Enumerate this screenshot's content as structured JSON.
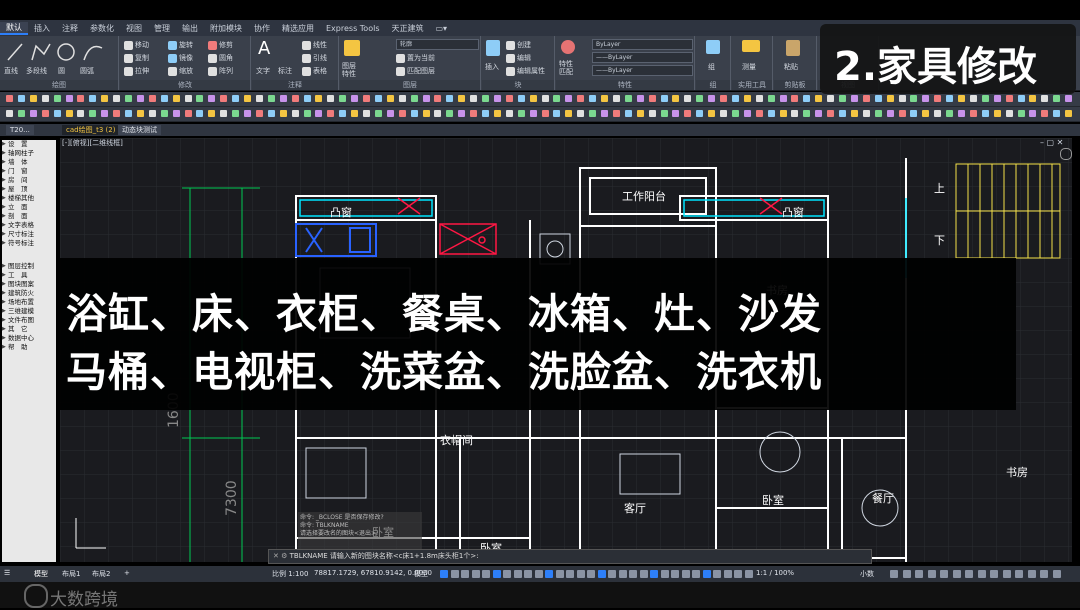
{
  "menu": {
    "tabs": [
      "默认",
      "插入",
      "注释",
      "参数化",
      "视图",
      "管理",
      "输出",
      "附加模块",
      "协作",
      "精选应用",
      "Express Tools",
      "天正建筑",
      "▭▾"
    ]
  },
  "ribbon": {
    "draw": {
      "label": "绘图",
      "line": "直线",
      "polyline": "多段线",
      "circle": "圆",
      "arc": "圆弧"
    },
    "modify": {
      "label": "修改",
      "move": "移动",
      "rotate": "旋转",
      "trim": "修剪",
      "copy": "复制",
      "mirror": "镜像",
      "fillet": "圆角",
      "stretch": "拉伸",
      "scale": "缩放",
      "array": "阵列"
    },
    "annotation": {
      "label": "注释",
      "text": "文字",
      "dimension": "标注",
      "linear": "线性",
      "leader": "引线",
      "table": "表格"
    },
    "layers": {
      "label": "图层",
      "props": "图层\n特性",
      "layer_name": "轮廓",
      "make_current": "置为当前",
      "match_layer": "匹配图层"
    },
    "block": {
      "label": "块",
      "insert": "插入",
      "create": "创建",
      "edit": "编辑",
      "edit_attr": "编辑属性"
    },
    "properties": {
      "label": "特性",
      "match": "特性\n匹配",
      "bylayer1": "ByLayer",
      "bylayer2": "——ByLayer",
      "bylayer3": "——ByLayer"
    },
    "groups": {
      "label": "组",
      "group": "组"
    },
    "utilities": {
      "label": "实用工具",
      "measure": "测量"
    },
    "clipboard": {
      "label": "剪贴板",
      "paste": "粘贴"
    },
    "view": {
      "label": "视图"
    }
  },
  "doc_tabs": [
    "T20...",
    "cad绘图_t3 (2)",
    "动态块测试"
  ],
  "viewport_label": "[-][俯视][二维线框]",
  "palette": {
    "items1": [
      "设　置",
      "轴网柱子",
      "墙　体",
      "门　窗",
      "房　间",
      "屋　顶",
      "楼梯其他",
      "立　面",
      "剖　面",
      "文字表格",
      "尺寸标注",
      "符号标注"
    ],
    "items2": [
      "图层控制",
      "工　具",
      "图块图案",
      "建筑防火",
      "场地布置",
      "三维建模",
      "文件布图",
      "其　它",
      "数据中心",
      "帮　助"
    ]
  },
  "rooms": {
    "bay_window_left": "凸窗",
    "bay_window_right": "凸窗",
    "work_balcony": "工作阳台",
    "study_top": "书房",
    "closet": "衣帽间",
    "living": "客厅",
    "bedroom_center": "卧室",
    "dining": "餐厅",
    "study_right": "书房",
    "bedroom_bottom": "卧室",
    "bedroom_left": "卧室",
    "up": "上",
    "down": "下"
  },
  "dimensions": {
    "d1": "1600",
    "d2": "7300"
  },
  "banner": {
    "line1": "浴缸、床、衣柜、餐桌、冰箱、灶、沙发",
    "line2": "马桶、电视柜、洗菜盆、洗脸盆、洗衣机"
  },
  "title_box": "2.家具修改",
  "command": {
    "history1": "命令: _BCLOSE 是否保存修改?",
    "history2": "命令: TBLKNAME",
    "history3": "请选择要改名的图块<退出>:",
    "current": "TBLKNAME 请输入新的图块名称<c床1+1.8m床头柜1个>:"
  },
  "layout_tabs": [
    "模型",
    "布局1",
    "布局2",
    "+"
  ],
  "status": {
    "scale": "比例 1:100",
    "coords": "78817.1729, 67810.9142, 0.0000",
    "model": "模型",
    "annoscale": "1:1 / 100%",
    "units": "小数"
  },
  "watermark": "大数跨境",
  "colors": {
    "accent": "#2d7ff9",
    "cad_bg": "#1a1b1f",
    "ribbon": "#3a404b",
    "wall": "#ffffff",
    "window": "#00e5ff",
    "dim": "#00c853",
    "furniture_sel": "#2962ff",
    "door": "#ff1744"
  }
}
